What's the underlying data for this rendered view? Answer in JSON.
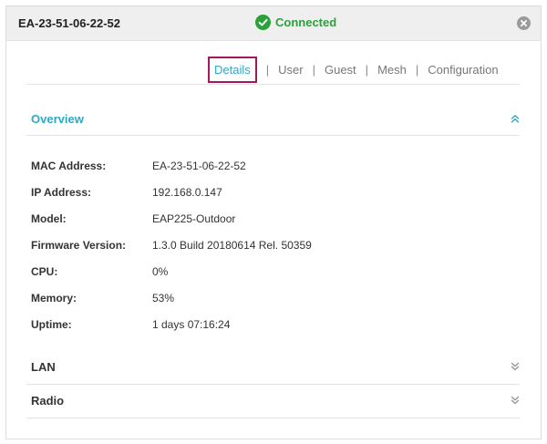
{
  "header": {
    "device_name": "EA-23-51-06-22-52",
    "status_text": "Connected",
    "status_color": "#2aa23a",
    "status_icon": "check-circle-icon",
    "close_icon": "close-circle-icon"
  },
  "tabs": [
    {
      "label": "Details",
      "active": true
    },
    {
      "label": "User",
      "active": false
    },
    {
      "label": "Guest",
      "active": false
    },
    {
      "label": "Mesh",
      "active": false
    },
    {
      "label": "Configuration",
      "active": false
    }
  ],
  "tab_separator": "|",
  "sections": {
    "overview": {
      "title": "Overview",
      "expanded": true,
      "chevron_icon": "double-chevron-up-icon",
      "rows": [
        {
          "label": "MAC Address:",
          "value": "EA-23-51-06-22-52"
        },
        {
          "label": "IP Address:",
          "value": "192.168.0.147"
        },
        {
          "label": "Model:",
          "value": "EAP225-Outdoor"
        },
        {
          "label": "Firmware Version:",
          "value": "1.3.0 Build 20180614 Rel. 50359"
        },
        {
          "label": "CPU:",
          "value": "0%"
        },
        {
          "label": "Memory:",
          "value": "53%"
        },
        {
          "label": "Uptime:",
          "value": "1 days 07:16:24"
        }
      ]
    },
    "lan": {
      "title": "LAN",
      "expanded": false,
      "chevron_icon": "double-chevron-down-icon"
    },
    "radio": {
      "title": "Radio",
      "expanded": false,
      "chevron_icon": "double-chevron-down-icon"
    }
  },
  "colors": {
    "accent": "#2da9c6",
    "highlight_box": "#a3195b",
    "header_bg": "#efefef"
  }
}
